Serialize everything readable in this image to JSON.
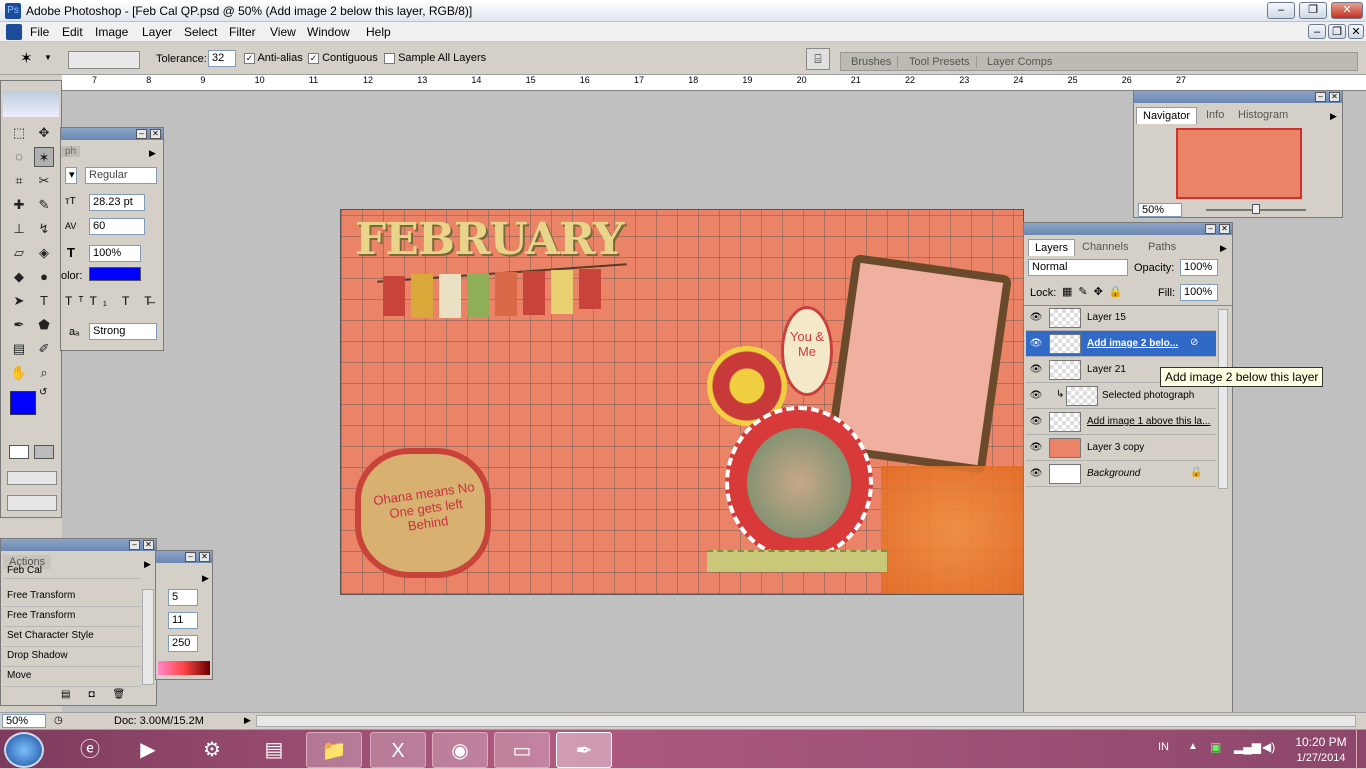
{
  "window": {
    "title": "Adobe Photoshop - [Feb Cal QP.psd @ 50% (Add image 2 below this layer, RGB/8)]"
  },
  "menu": [
    "File",
    "Edit",
    "Image",
    "Layer",
    "Select",
    "Filter",
    "View",
    "Window",
    "Help"
  ],
  "options": {
    "tolerance_label": "Tolerance:",
    "tolerance_value": "32",
    "antialias_label": "Anti-alias",
    "contiguous_label": "Contiguous",
    "sample_all_label": "Sample All Layers"
  },
  "palette_well": [
    "Brushes",
    "Tool Presets",
    "Layer Comps"
  ],
  "ruler_ticks": [
    "7",
    "8",
    "9",
    "10",
    "11",
    "12",
    "13",
    "14",
    "15",
    "16",
    "17",
    "18",
    "19",
    "20",
    "21",
    "22",
    "23",
    "24",
    "25",
    "26",
    "27"
  ],
  "character": {
    "tab": "ph",
    "style": "Regular",
    "size": "28.23 pt",
    "tracking": "60",
    "scale": "100%",
    "color_label": "olor:",
    "antialias": "Strong"
  },
  "navigator": {
    "tabs": [
      "Navigator",
      "Info",
      "Histogram"
    ],
    "zoom": "50%"
  },
  "layers_panel": {
    "tabs": [
      "Layers",
      "Channels",
      "Paths"
    ],
    "blend_mode": "Normal",
    "opacity_label": "Opacity:",
    "opacity": "100%",
    "lock_label": "Lock:",
    "fill_label": "Fill:",
    "fill": "100%",
    "layers": [
      "Layer 15",
      "Add image 2 belo...",
      "Layer 21",
      "Selected photograph",
      "Add image 1 above this la...",
      "Layer 3 copy",
      "Background"
    ],
    "tooltip": "Add image 2 below this layer"
  },
  "actions": {
    "tab": "Actions",
    "items": [
      "Feb Cal",
      "Free Transform",
      "Free Transform",
      "Set Character Style",
      "Drop Shadow",
      "Move"
    ]
  },
  "color_panel": {
    "values": [
      "5",
      "11",
      "250"
    ]
  },
  "canvas": {
    "title_text": "FEBRUARY",
    "frame_text": "You & Me",
    "quote": "Ohana means No One gets left Behind"
  },
  "status": {
    "zoom": "50%",
    "doc": "Doc: 3.00M/15.2M"
  },
  "taskbar": {
    "lang": "IN",
    "time": "10:20 PM",
    "date": "1/27/2014"
  },
  "colors": {
    "foreground": "#0000ff",
    "canvas_bg": "#eb8467",
    "selected_layer": "#3169c6"
  }
}
